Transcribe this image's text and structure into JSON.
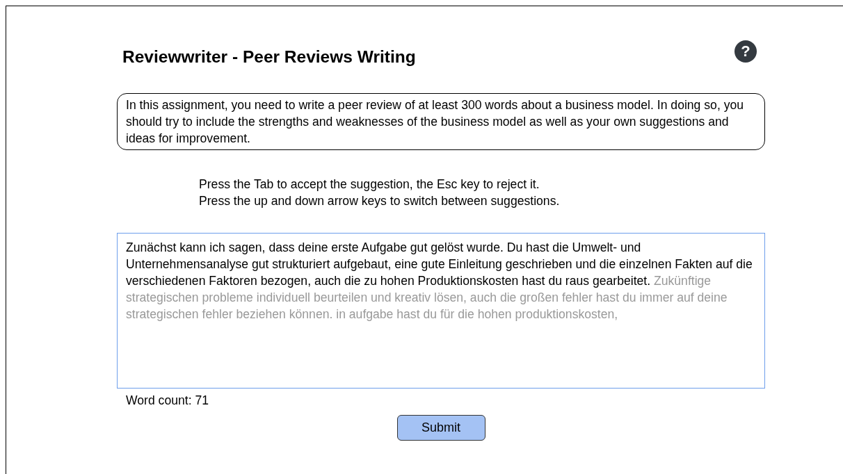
{
  "title": "Reviewwriter - Peer Reviews Writing",
  "help_button": {
    "glyph": "?"
  },
  "assignment": "In this assignment, you need to write a peer review of at least 300 words about a business model. In doing so, you should try to include the strengths and weaknesses of the business model as well as your own suggestions and ideas for improvement.",
  "hints": [
    "Press the Tab to accept the suggestion, the Esc key to reject it.",
    "Press the up and down arrow keys to switch between suggestions."
  ],
  "editor": {
    "value": "Zunächst kann ich sagen, dass deine erste Aufgabe gut gelöst wurde. Du hast die Umwelt- und Unternehmensanalyse gut strukturiert aufgebaut, eine gute Einleitung geschrieben und die einzelnen Fakten auf die verschiedenen Faktoren bezogen, auch die zu hohen Produktionskosten hast du raus gearbeitet.",
    "suggestion": "Zukünftige strategischen probleme individuell beurteilen und kreativ lösen, auch die großen fehler hast du immer auf deine strategischen fehler beziehen können. in aufgabe hast du für die hohen produktionskosten,"
  },
  "word_count": "Word count: 71",
  "submit_button": "Submit"
}
